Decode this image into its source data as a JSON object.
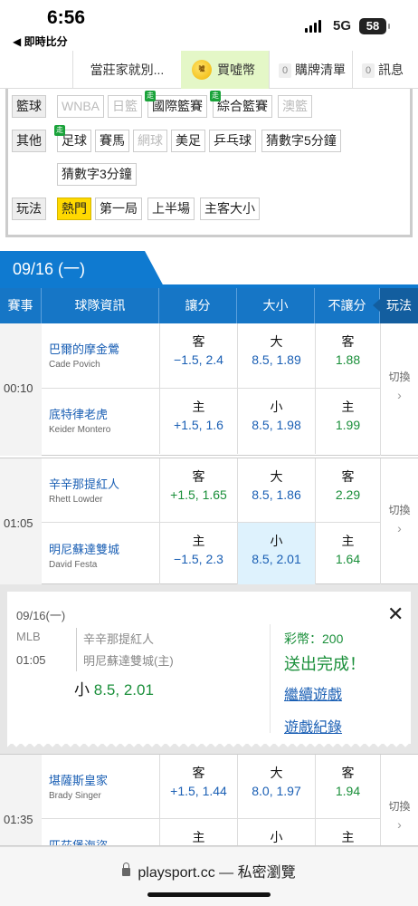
{
  "status": {
    "time": "6:56",
    "back_label": "◀ 即時比分",
    "network": "5G",
    "battery": "58"
  },
  "nav": {
    "banker": "當莊家就別...",
    "buy": "買噓幣",
    "coin_icon_text": "噓",
    "cart_count": "0",
    "cart": "購牌清單",
    "msg_count": "0",
    "msg": "訊息"
  },
  "filters": {
    "basketball_label": "籃球",
    "basketball": [
      "WNBA",
      "日籃",
      "國際籃賽",
      "綜合籃賽",
      "澳籃"
    ],
    "other_label": "其他",
    "other": [
      "足球",
      "賽馬",
      "網球",
      "美足",
      "乒乓球",
      "猜數字5分鐘",
      "猜數字3分鐘"
    ],
    "play_label": "玩法",
    "play": [
      "熱門",
      "第一局",
      "上半場",
      "主客大小"
    ],
    "badge": "走"
  },
  "date_tab": "09/16 (一)",
  "headers": [
    "賽事",
    "球隊資訊",
    "讓分",
    "大小",
    "不讓分",
    "玩法"
  ],
  "games": [
    {
      "time": "00:10",
      "rows": [
        {
          "team": "巴爾的摩金鶯",
          "pitcher": "Cade Povich",
          "spread_k": "客",
          "spread_v": "−1.5, 2.4",
          "total_k": "大",
          "total_v": "8.5, 1.89",
          "ml_k": "客",
          "ml_v": "1.88"
        },
        {
          "team": "底特律老虎",
          "pitcher": "Keider Montero",
          "spread_k": "主",
          "spread_v": "+1.5, 1.6",
          "total_k": "小",
          "total_v": "8.5, 1.98",
          "ml_k": "主",
          "ml_v": "1.99"
        }
      ]
    },
    {
      "time": "01:05",
      "rows": [
        {
          "team": "辛辛那提紅人",
          "pitcher": "Rhett Lowder",
          "spread_k": "客",
          "spread_v": "+1.5, 1.65",
          "total_k": "大",
          "total_v": "8.5, 1.86",
          "ml_k": "客",
          "ml_v": "2.29"
        },
        {
          "team": "明尼蘇達雙城",
          "pitcher": "David Festa",
          "spread_k": "主",
          "spread_v": "−1.5, 2.3",
          "total_k": "小",
          "total_v": "8.5, 2.01",
          "ml_k": "主",
          "ml_v": "1.64"
        }
      ]
    },
    {
      "time": "01:35",
      "rows": [
        {
          "team": "堪薩斯皇家",
          "pitcher": "Brady Singer",
          "spread_k": "客",
          "spread_v": "+1.5, 1.44",
          "total_k": "大",
          "total_v": "8.0, 1.97",
          "ml_k": "客",
          "ml_v": "1.94"
        },
        {
          "team": "匹茲堡海盜",
          "pitcher": "",
          "spread_k": "主",
          "spread_v": "",
          "total_k": "小",
          "total_v": "",
          "ml_k": "主",
          "ml_v": ""
        }
      ]
    }
  ],
  "switch_label": "切換",
  "popup": {
    "date": "09/16(一)",
    "league": "MLB",
    "time": "01:05",
    "team1": "辛辛那提紅人",
    "team2": "明尼蘇達雙城(主)",
    "bet_k": "小",
    "bet_v": "8.5, 2.01",
    "coins": "彩幣：200",
    "done": "送出完成！",
    "continue": "繼續遊戲",
    "record": "遊戲紀錄",
    "close": "✕"
  },
  "browser": {
    "url": "playsport.cc — 私密瀏覽"
  }
}
